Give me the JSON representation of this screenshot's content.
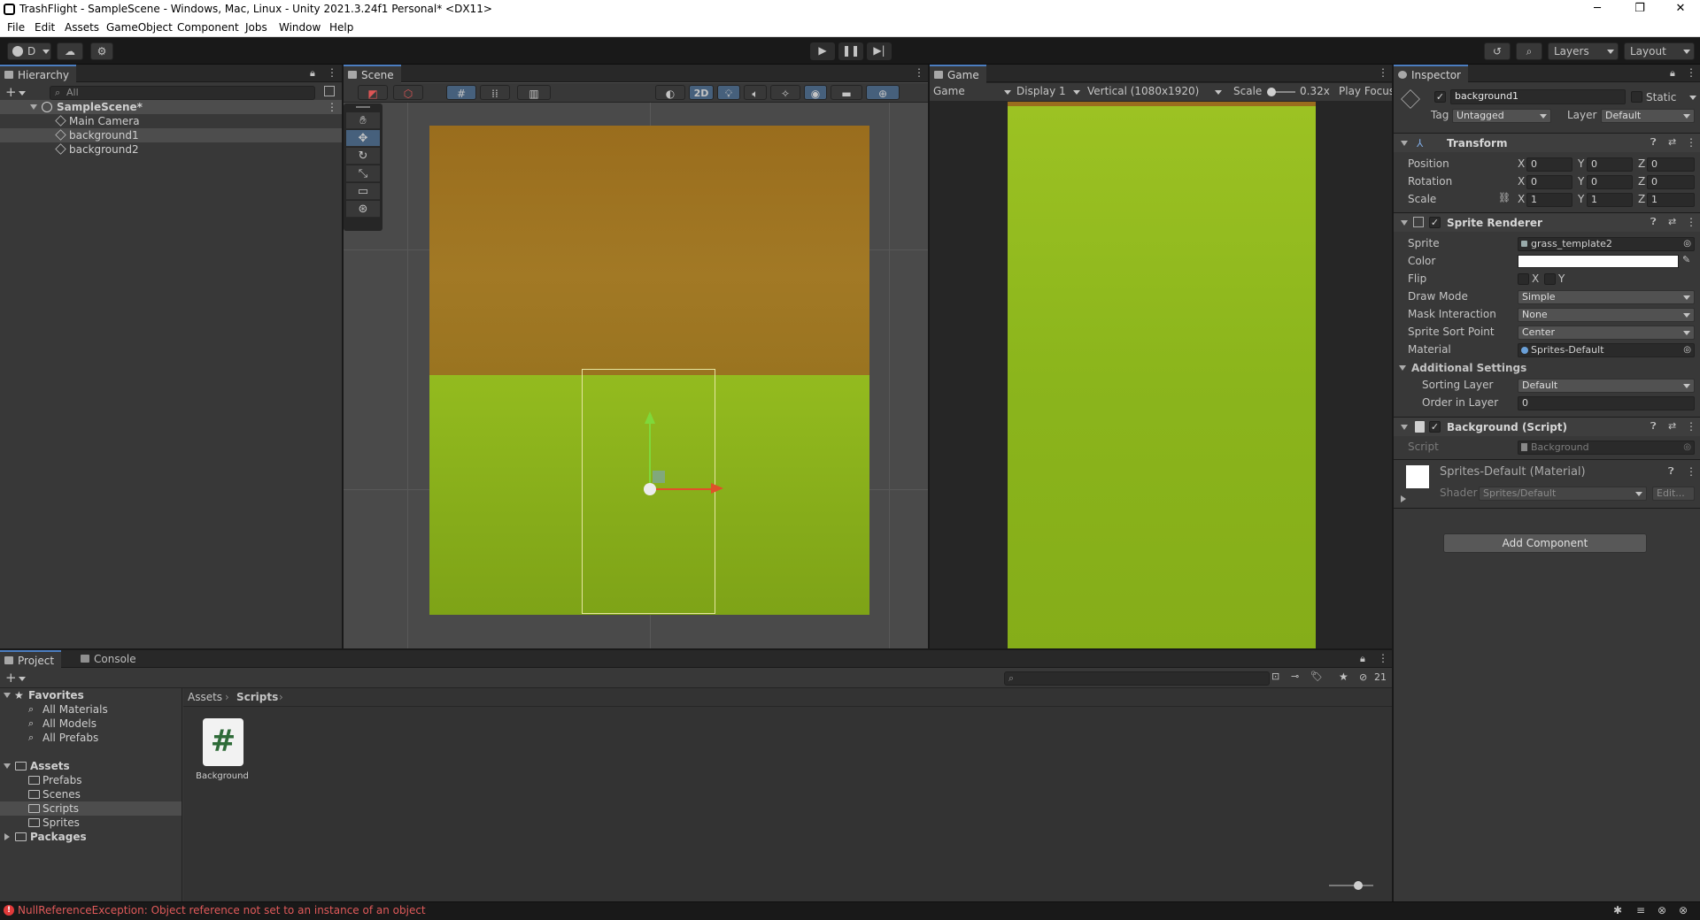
{
  "window": {
    "title": "TrashFlight - SampleScene - Windows, Mac, Linux - Unity 2021.3.24f1 Personal* <DX11>",
    "controls": [
      "─",
      "❐",
      "✕"
    ]
  },
  "menu": [
    "File",
    "Edit",
    "Assets",
    "GameObject",
    "Component",
    "Jobs",
    "Window",
    "Help"
  ],
  "toolbar": {
    "account_label": "D",
    "layers_label": "Layers",
    "layout_label": "Layout"
  },
  "hierarchy": {
    "tab": "Hierarchy",
    "search_placeholder": "All",
    "scene": "SampleScene*",
    "items": [
      "Main Camera",
      "background1",
      "background2"
    ]
  },
  "scene_view": {
    "tab": "Scene",
    "mode_2d": "2D"
  },
  "game_view": {
    "tab": "Game",
    "view_select": "Game",
    "display": "Display 1",
    "resolution": "Vertical (1080x1920)",
    "scale_label": "Scale",
    "scale_value": "0.32x",
    "play_focus": "Play Focus"
  },
  "inspector": {
    "tab": "Inspector",
    "object_name": "background1",
    "static_label": "Static",
    "tag_label": "Tag",
    "tag_value": "Untagged",
    "layer_label": "Layer",
    "layer_value": "Default",
    "transform": {
      "title": "Transform",
      "rows": [
        {
          "label": "Position",
          "x": "0",
          "y": "0",
          "z": "0"
        },
        {
          "label": "Rotation",
          "x": "0",
          "y": "0",
          "z": "0"
        },
        {
          "label": "Scale",
          "x": "1",
          "y": "1",
          "z": "1"
        }
      ],
      "axis": [
        "X",
        "Y",
        "Z"
      ]
    },
    "sprite_renderer": {
      "title": "Sprite Renderer",
      "sprite_label": "Sprite",
      "sprite_value": "grass_template2",
      "color_label": "Color",
      "color_value": "#ffffff",
      "flip_label": "Flip",
      "flip_x": "X",
      "flip_y": "Y",
      "draw_mode_label": "Draw Mode",
      "draw_mode_value": "Simple",
      "mask_label": "Mask Interaction",
      "mask_value": "None",
      "sort_point_label": "Sprite Sort Point",
      "sort_point_value": "Center",
      "material_label": "Material",
      "material_value": "Sprites-Default",
      "additional_label": "Additional Settings",
      "sorting_layer_label": "Sorting Layer",
      "sorting_layer_value": "Default",
      "order_label": "Order in Layer",
      "order_value": "0"
    },
    "background_script": {
      "title": "Background (Script)",
      "script_label": "Script",
      "script_value": "Background"
    },
    "material": {
      "title": "Sprites-Default (Material)",
      "shader_label": "Shader",
      "shader_value": "Sprites/Default",
      "edit_label": "Edit..."
    },
    "add_component": "Add Component"
  },
  "project": {
    "tabs": [
      "Project",
      "Console"
    ],
    "favorites_label": "Favorites",
    "favorites": [
      "All Materials",
      "All Models",
      "All Prefabs"
    ],
    "assets_label": "Assets",
    "asset_folders": [
      "Prefabs",
      "Scenes",
      "Scripts",
      "Sprites"
    ],
    "packages_label": "Packages",
    "breadcrumb": [
      "Assets",
      "Scripts"
    ],
    "hidden_count": "21",
    "files": [
      {
        "name": "Background",
        "glyph": "#"
      }
    ]
  },
  "status": {
    "error": "NullReferenceException: Object reference not set to an instance of an object"
  }
}
